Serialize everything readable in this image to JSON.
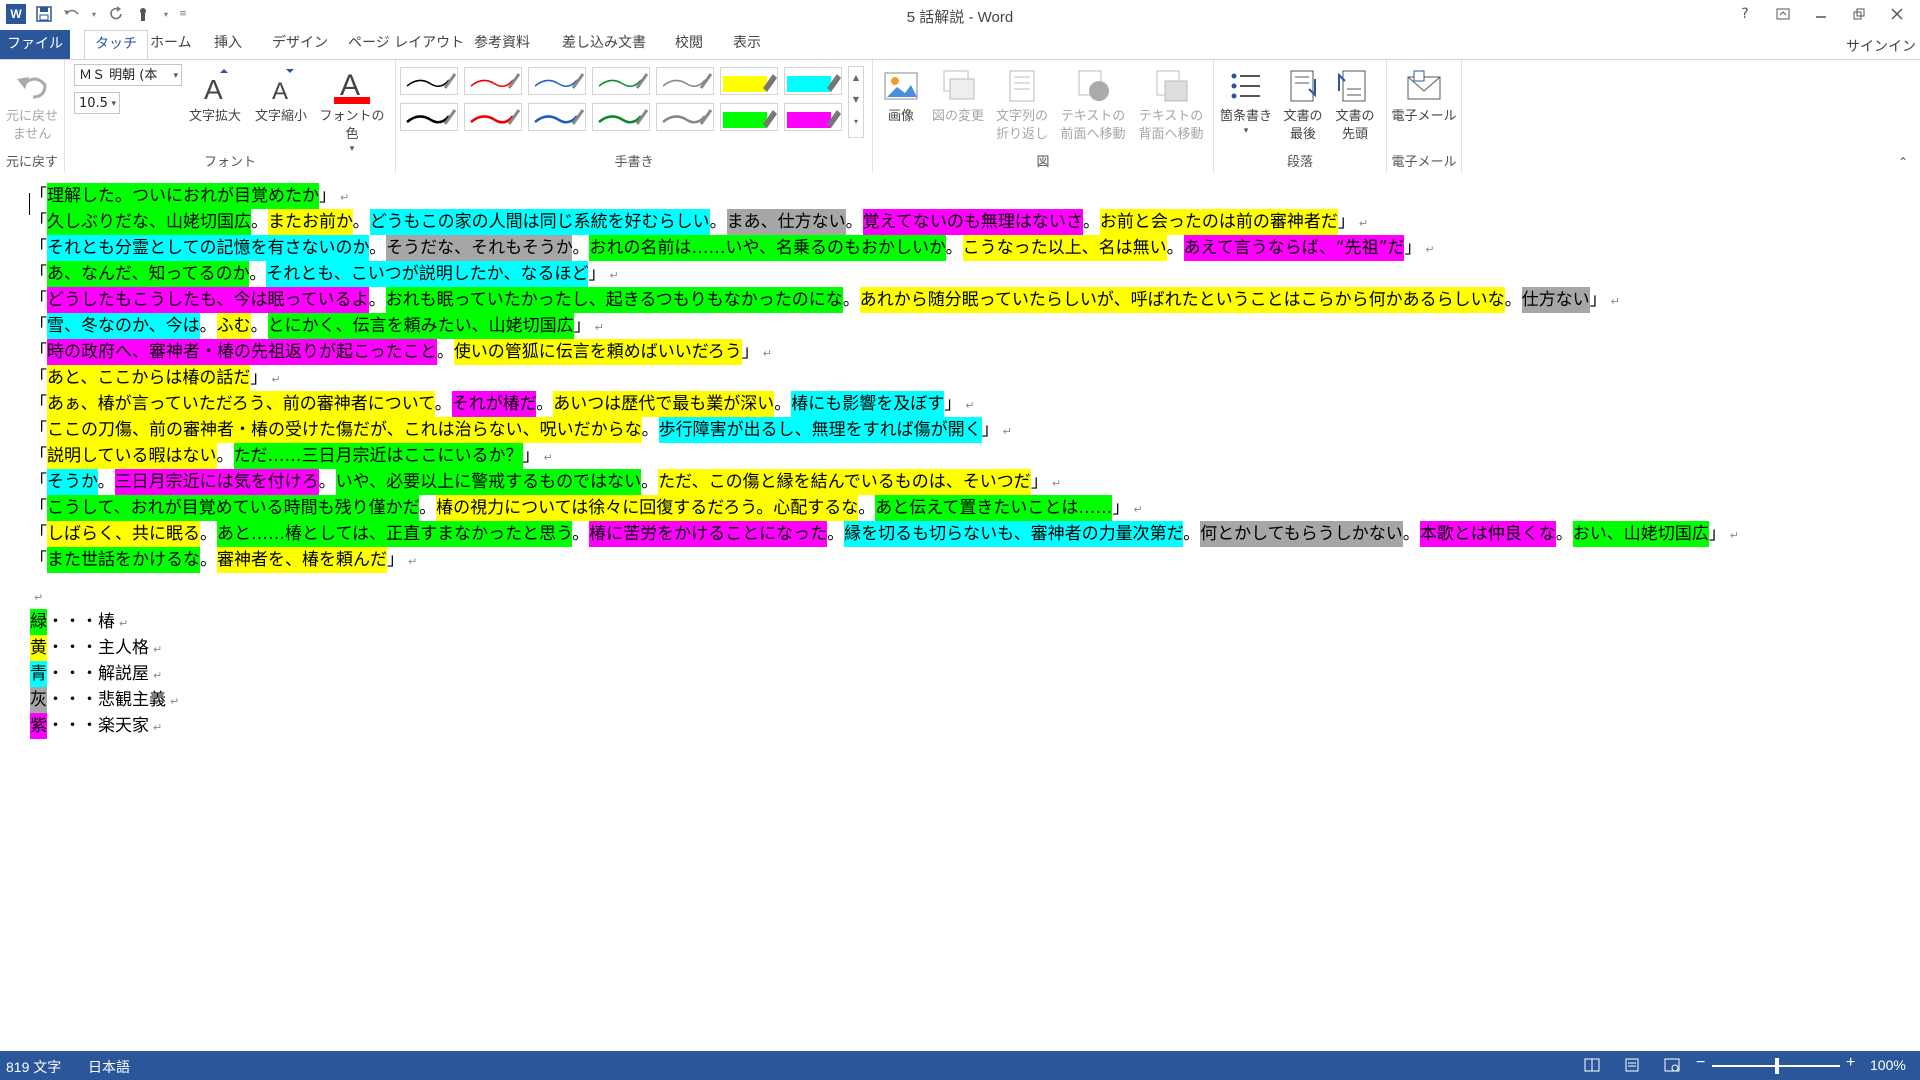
{
  "window": {
    "title": "5 話解説 - Word",
    "help": "?",
    "signin": "サインイン"
  },
  "qat": {
    "logo": "W"
  },
  "tabs": [
    {
      "label": "ファイル",
      "x": 0
    },
    {
      "label": "タッチ"
    },
    {
      "label": "ホーム"
    },
    {
      "label": "挿入"
    },
    {
      "label": "デザイン"
    },
    {
      "label": "ページ レイアウト"
    },
    {
      "label": "参考資料"
    },
    {
      "label": "差し込み文書"
    },
    {
      "label": "校閲"
    },
    {
      "label": "表示"
    }
  ],
  "ribbon": {
    "undo": {
      "label1": "元に戻せ",
      "label2": "ません",
      "group": "元に戻す"
    },
    "font": {
      "name": "ＭＳ 明朝 (本",
      "size": "10.5",
      "grow": "文字拡大",
      "shrink": "文字縮小",
      "color": "フォントの色",
      "group": "フォント"
    },
    "pens": {
      "group": "手書き"
    },
    "picture": {
      "image": "画像",
      "change": "図の変更",
      "wrap1": "文字列の",
      "wrap2": "折り返し",
      "front1": "テキストの",
      "front2": "前面へ移動",
      "back1": "テキストの",
      "back2": "背面へ移動",
      "group": "図"
    },
    "paragraph": {
      "bullets": "箇条書き",
      "end1": "文書の",
      "end2": "最後",
      "top1": "文書の",
      "top2": "先頭",
      "group": "段落"
    },
    "email": {
      "label": "電子メール",
      "group": "電子メール"
    }
  },
  "colors": {
    "green": "#00ff00",
    "yellow": "#ffff00",
    "cyan": "#00ffff",
    "gray": "#a6a6a6",
    "magenta": "#ff00ff",
    "word_blue": "#2b579a"
  },
  "document": {
    "lines": [
      [
        [
          "「",
          ""
        ],
        [
          "理解した。ついにおれが目覚めたか",
          "green"
        ],
        [
          "」",
          ""
        ]
      ],
      [
        [
          "「",
          ""
        ],
        [
          "久しぶりだな、山姥切国広",
          "green"
        ],
        [
          "。",
          ""
        ],
        [
          "またお前か",
          "yellow"
        ],
        [
          "。",
          ""
        ],
        [
          "どうもこの家の人間は同じ系統を好むらしい",
          "cyan"
        ],
        [
          "。",
          ""
        ],
        [
          "まあ、仕方ない",
          "gray"
        ],
        [
          "。",
          ""
        ],
        [
          "覚えてないのも無理はないさ",
          "magenta"
        ],
        [
          "。",
          ""
        ],
        [
          "お前と会ったのは前の審神者だ",
          "yellow"
        ],
        [
          "」",
          ""
        ]
      ],
      [
        [
          "「",
          ""
        ],
        [
          "それとも分霊としての記憶を有さないのか",
          "cyan"
        ],
        [
          "。",
          ""
        ],
        [
          "そうだな、それもそうか",
          "gray"
        ],
        [
          "。",
          ""
        ],
        [
          "おれの名前は……いや、名乗るのもおかしいか",
          "green"
        ],
        [
          "。",
          ""
        ],
        [
          "こうなった以上、名は無い",
          "yellow"
        ],
        [
          "。",
          ""
        ],
        [
          "あえて言うならば、“先祖”だ",
          "magenta"
        ],
        [
          "」",
          ""
        ]
      ],
      [
        [
          "「",
          ""
        ],
        [
          "あ、なんだ、知ってるのか",
          "green"
        ],
        [
          "。",
          ""
        ],
        [
          "それとも、こいつが説明したか、なるほど",
          "cyan"
        ],
        [
          "」",
          ""
        ]
      ],
      [
        [
          "「",
          ""
        ],
        [
          "どうしたもこうしたも、今は眠っているよ",
          "magenta"
        ],
        [
          "。",
          ""
        ],
        [
          "おれも眠っていたかったし、起きるつもりもなかったのにな",
          "green"
        ],
        [
          "。",
          ""
        ],
        [
          "あれから随分眠っていたらしいが、呼ばれたということはこらから何かあるらしいな",
          "yellow"
        ],
        [
          "。",
          ""
        ],
        [
          "仕方ない",
          "gray"
        ],
        [
          "」",
          ""
        ]
      ],
      [
        [
          "「",
          ""
        ],
        [
          "雪、冬なのか、今は",
          "cyan"
        ],
        [
          "。",
          ""
        ],
        [
          "ふむ",
          "yellow"
        ],
        [
          "。",
          ""
        ],
        [
          "とにかく、伝言を頼みたい、山姥切国広",
          "green"
        ],
        [
          "」",
          ""
        ]
      ],
      [
        [
          "「",
          ""
        ],
        [
          "時の政府へ、審神者・椿の先祖返りが起こったこと",
          "magenta"
        ],
        [
          "。",
          ""
        ],
        [
          "使いの管狐に伝言を頼めばいいだろう",
          "yellow"
        ],
        [
          "」",
          ""
        ]
      ],
      [
        [
          "「",
          ""
        ],
        [
          "あと、ここからは椿の話だ",
          "yellow"
        ],
        [
          "」",
          ""
        ]
      ],
      [
        [
          "「",
          ""
        ],
        [
          "あぁ、椿が言っていただろう、前の審神者について",
          "yellow"
        ],
        [
          "。",
          ""
        ],
        [
          "それが椿だ",
          "magenta"
        ],
        [
          "。",
          ""
        ],
        [
          "あいつは歴代で最も業が深い",
          "yellow"
        ],
        [
          "。",
          ""
        ],
        [
          "椿にも影響を及ぼす",
          "cyan"
        ],
        [
          "」",
          ""
        ]
      ],
      [
        [
          "「",
          ""
        ],
        [
          "ここの刀傷、前の審神者・椿の受けた傷だが、これは治らない、呪いだからな",
          "yellow"
        ],
        [
          "。",
          ""
        ],
        [
          "歩行障害が出るし、無理をすれば傷が開く",
          "cyan"
        ],
        [
          "」",
          ""
        ]
      ],
      [
        [
          "「",
          ""
        ],
        [
          "説明している暇はない",
          "yellow"
        ],
        [
          "。",
          ""
        ],
        [
          "ただ……三日月宗近はここにいるか？",
          "green"
        ],
        [
          "」",
          ""
        ]
      ],
      [
        [
          "「",
          ""
        ],
        [
          "そうか",
          "cyan"
        ],
        [
          "。",
          ""
        ],
        [
          "三日月宗近には気を付けろ",
          "magenta"
        ],
        [
          "。",
          ""
        ],
        [
          "いや、必要以上に警戒するものではない",
          "green"
        ],
        [
          "。",
          ""
        ],
        [
          "ただ、この傷と縁を結んでいるものは、そいつだ",
          "yellow"
        ],
        [
          "」",
          ""
        ]
      ],
      [
        [
          "「",
          ""
        ],
        [
          "こうして、おれが目覚めている時間も残り僅かだ",
          "green"
        ],
        [
          "。",
          ""
        ],
        [
          "椿の視力については徐々に回復するだろう。心配するな",
          "yellow"
        ],
        [
          "。",
          ""
        ],
        [
          "あと伝えて置きたいことは……",
          "green"
        ],
        [
          "」",
          ""
        ]
      ],
      [
        [
          "「",
          ""
        ],
        [
          "しばらく、共に眠る",
          "yellow"
        ],
        [
          "。",
          ""
        ],
        [
          "あと……椿としては、正直すまなかったと思う",
          "green"
        ],
        [
          "。",
          ""
        ],
        [
          "椿に苦労をかけることになった",
          "magenta"
        ],
        [
          "。",
          ""
        ],
        [
          "縁を切るも切らないも、審神者の力量次第だ",
          "cyan"
        ],
        [
          "。",
          ""
        ],
        [
          "何とかしてもらうしかない",
          "gray"
        ],
        [
          "。",
          ""
        ],
        [
          "本歌とは仲良くな",
          "magenta"
        ],
        [
          "。",
          ""
        ],
        [
          "おい、山姥切国広",
          "green"
        ],
        [
          "」",
          ""
        ]
      ],
      [
        [
          "「",
          ""
        ],
        [
          "また世話をかけるな",
          "green"
        ],
        [
          "。",
          ""
        ],
        [
          "審神者を、椿を頼んだ",
          "yellow"
        ],
        [
          "」",
          ""
        ]
      ],
      [],
      [
        [
          "緑",
          "green"
        ],
        [
          "・・・椿",
          ""
        ]
      ],
      [
        [
          "黄",
          "yellow"
        ],
        [
          "・・・主人格",
          ""
        ]
      ],
      [
        [
          "青",
          "cyan"
        ],
        [
          "・・・解説屋",
          ""
        ]
      ],
      [
        [
          "灰",
          "gray"
        ],
        [
          "・・・悲観主義",
          ""
        ]
      ],
      [
        [
          "紫",
          "magenta"
        ],
        [
          "・・・楽天家",
          ""
        ]
      ]
    ]
  },
  "status": {
    "word_count": "819 文字",
    "language": "日本語",
    "zoom": "100%"
  }
}
